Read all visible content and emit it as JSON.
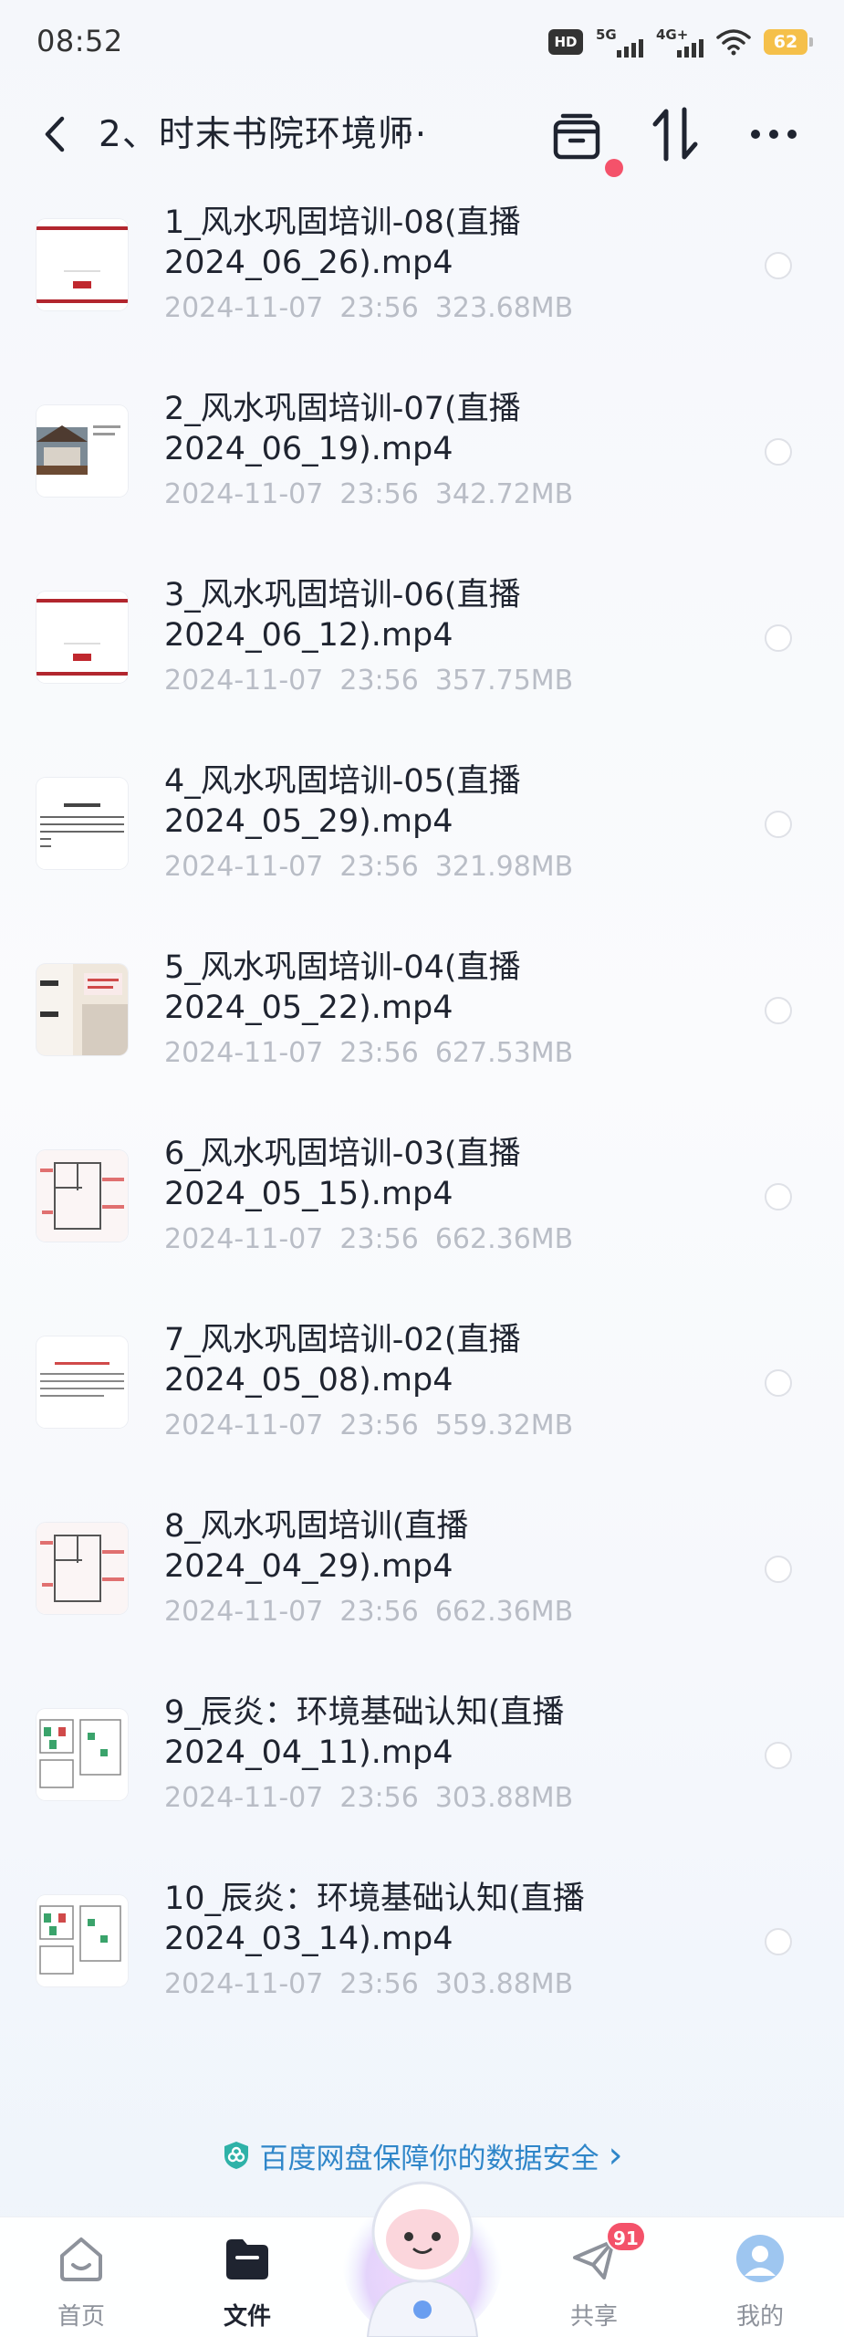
{
  "status_bar": {
    "time": "08:52",
    "hd_label": "HD",
    "net1_label": "5G",
    "net2_label": "4G+",
    "battery": "62",
    "icons": [
      "hd-icon",
      "signal-5g-icon",
      "signal-4g-icon",
      "wifi-icon",
      "battery-icon"
    ]
  },
  "header": {
    "title": "2、时末书院环境师",
    "ellipsis": "···",
    "back_icon": "chevron-left-icon",
    "actions": [
      "archive-icon",
      "sort-icon",
      "more-icon"
    ],
    "notice_dot_color": "#f4526a"
  },
  "files": [
    {
      "name_line1": "1_风水巩固培训-08(直播",
      "name_line2": "2024_06_26).mp4",
      "date": "2024-11-07",
      "time": "23:56",
      "size": "323.68MB",
      "thumb": "slide-title-red",
      "thumb_text": "应用风水"
    },
    {
      "name_line1": "2_风水巩固培训-07(直播",
      "name_line2": "2024_06_19).mp4",
      "date": "2024-11-07",
      "time": "23:56",
      "size": "342.72MB",
      "thumb": "slide-house",
      "thumb_text": ""
    },
    {
      "name_line1": "3_风水巩固培训-06(直播",
      "name_line2": "2024_06_12).mp4",
      "date": "2024-11-07",
      "time": "23:56",
      "size": "357.75MB",
      "thumb": "slide-title-red",
      "thumb_text": "桂花城"
    },
    {
      "name_line1": "4_风水巩固培训-05(直播",
      "name_line2": "2024_05_29).mp4",
      "date": "2024-11-07",
      "time": "23:56",
      "size": "321.98MB",
      "thumb": "slide-text",
      "thumb_text": "风水物品"
    },
    {
      "name_line1": "5_风水巩固培训-04(直播",
      "name_line2": "2024_05_22).mp4",
      "date": "2024-11-07",
      "time": "23:56",
      "size": "627.53MB",
      "thumb": "slide-photo",
      "thumb_text": "风水"
    },
    {
      "name_line1": "6_风水巩固培训-03(直播",
      "name_line2": "2024_05_15).mp4",
      "date": "2024-11-07",
      "time": "23:56",
      "size": "662.36MB",
      "thumb": "slide-floorplan",
      "thumb_text": ""
    },
    {
      "name_line1": "7_风水巩固培训-02(直播",
      "name_line2": "2024_05_08).mp4",
      "date": "2024-11-07",
      "time": "23:56",
      "size": "559.32MB",
      "thumb": "slide-doc",
      "thumb_text": ""
    },
    {
      "name_line1": "8_风水巩固培训(直播",
      "name_line2": "2024_04_29).mp4",
      "date": "2024-11-07",
      "time": "23:56",
      "size": "662.36MB",
      "thumb": "slide-floorplan",
      "thumb_text": ""
    },
    {
      "name_line1": "9_辰炎：环境基础认知(直播",
      "name_line2": "2024_04_11).mp4",
      "date": "2024-11-07",
      "time": "23:56",
      "size": "303.88MB",
      "thumb": "slide-grid",
      "thumb_text": ""
    },
    {
      "name_line1": "10_辰炎：环境基础认知(直播",
      "name_line2": "2024_03_14).mp4",
      "date": "2024-11-07",
      "time": "23:56",
      "size": "303.88MB",
      "thumb": "slide-grid",
      "thumb_text": ""
    }
  ],
  "safety_banner": {
    "text": "百度网盘保障你的数据安全",
    "arrow": "›",
    "icon": "shield-icon",
    "color": "#2f86c9"
  },
  "bottom_nav": {
    "items": [
      {
        "label": "首页",
        "icon": "home-icon",
        "active": false
      },
      {
        "label": "文件",
        "icon": "folder-icon",
        "active": true
      },
      {
        "label": "共享",
        "icon": "send-icon",
        "active": false,
        "badge": "91"
      },
      {
        "label": "我的",
        "icon": "avatar-icon",
        "active": false
      }
    ],
    "center": "mascot-icon"
  }
}
